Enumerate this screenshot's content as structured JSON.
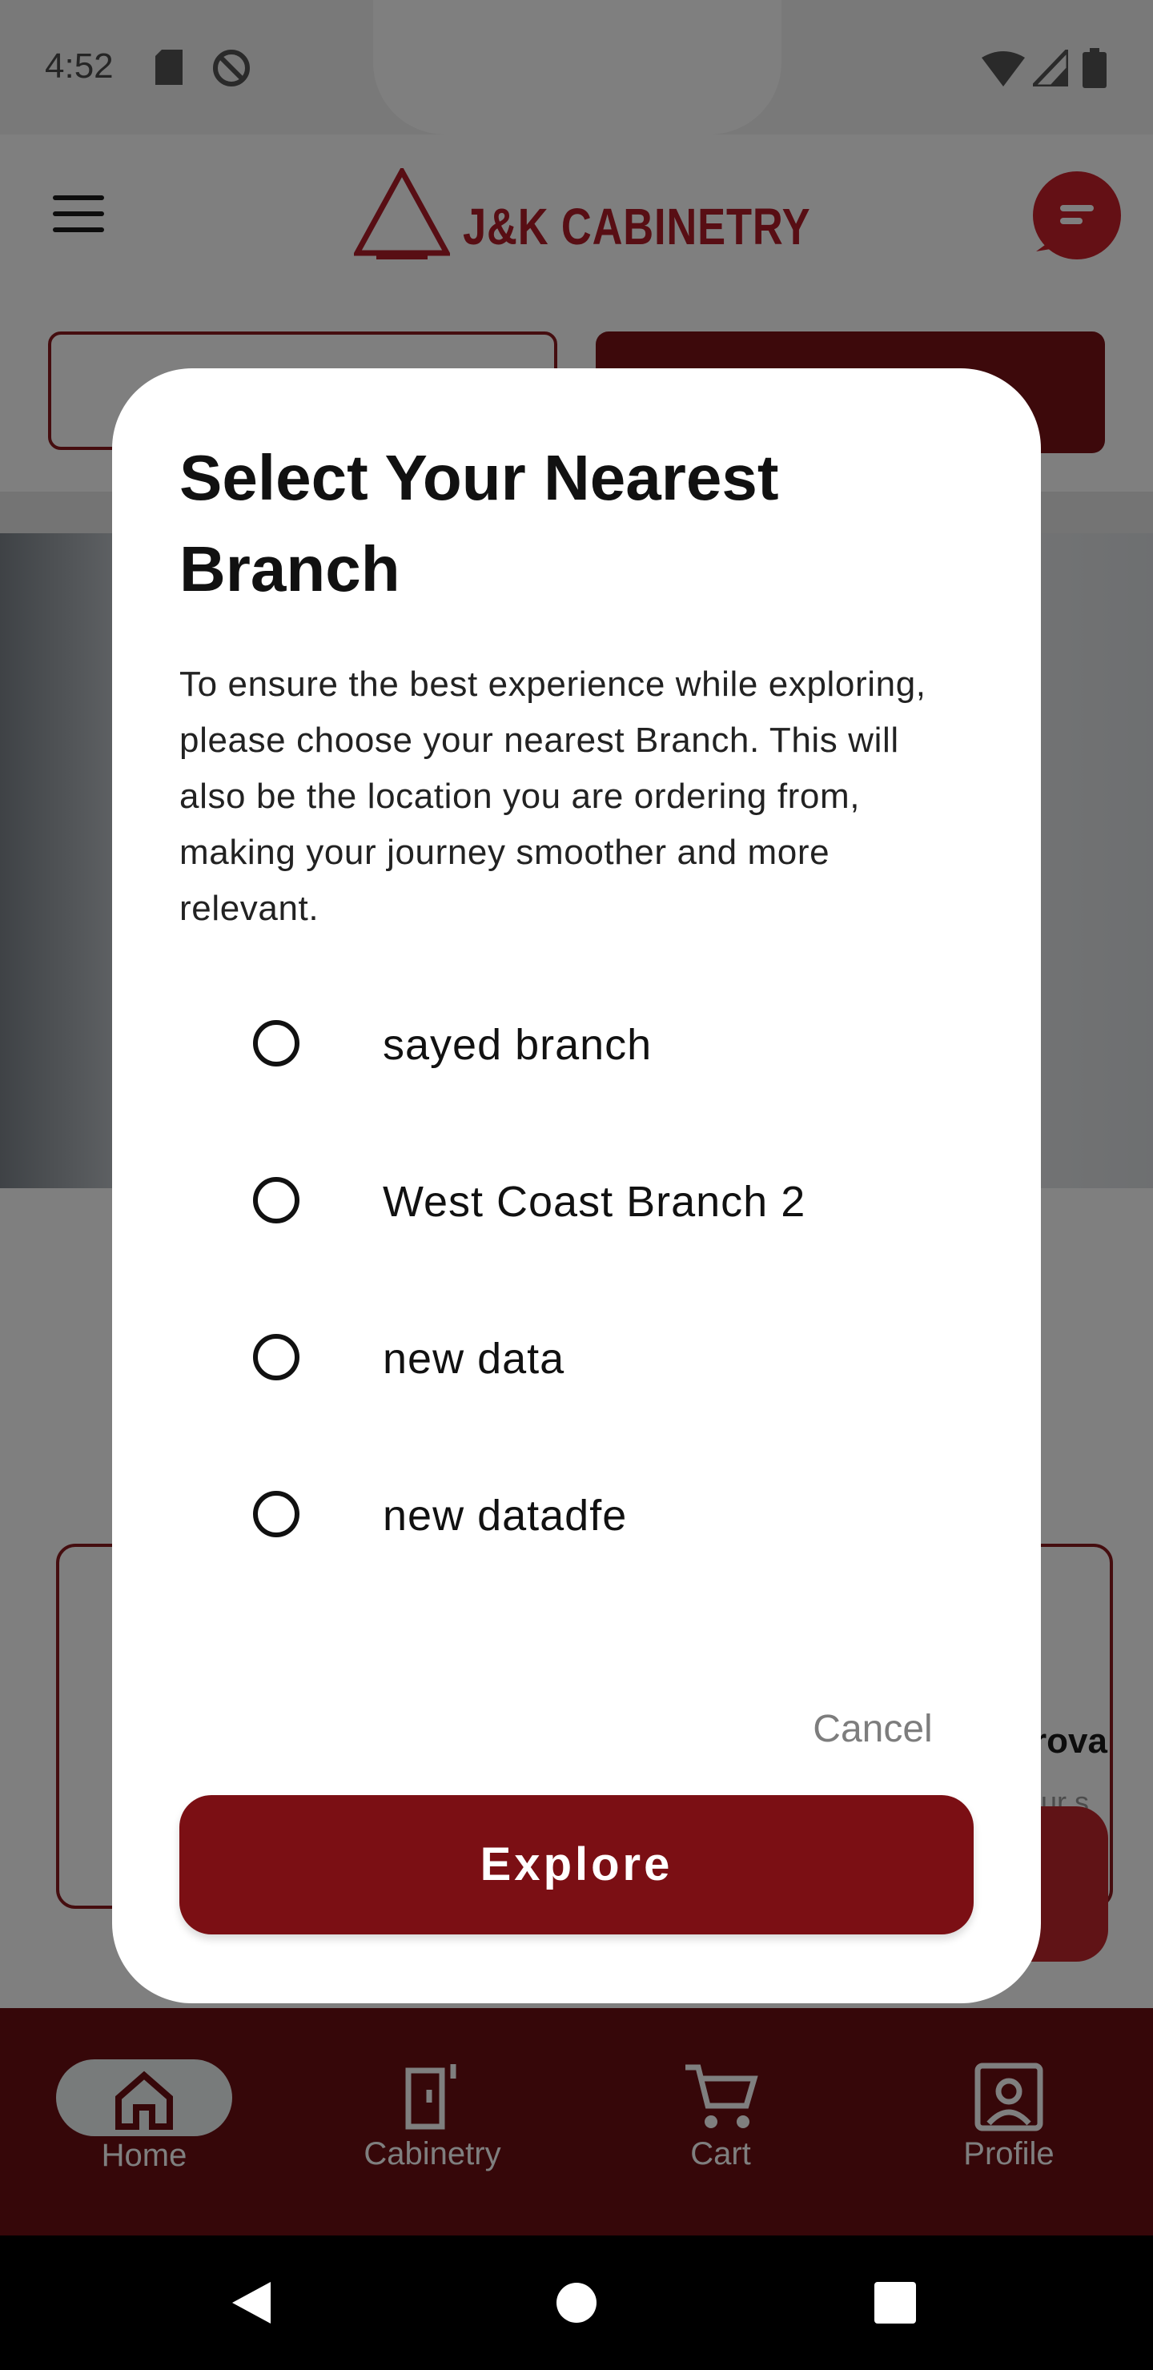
{
  "status_bar": {
    "time": "4:52"
  },
  "app_bar": {
    "logo_text": "J&K CABINETRY"
  },
  "background": {
    "partial_heading": "rova",
    "partial_sub": "ur s"
  },
  "bottom_nav": {
    "items": [
      {
        "label": "Home",
        "icon": "home-icon",
        "selected": true
      },
      {
        "label": "Cabinetry",
        "icon": "cabinet-icon",
        "selected": false
      },
      {
        "label": "Cart",
        "icon": "cart-icon",
        "selected": false
      },
      {
        "label": "Profile",
        "icon": "profile-icon",
        "selected": false
      }
    ]
  },
  "dialog": {
    "title": "Select Your Nearest Branch",
    "body": "To ensure the best experience while exploring, please choose your nearest Branch. This will also be the location you are ordering from, making your journey smoother and more relevant.",
    "options": [
      {
        "label": "sayed branch",
        "selected": false
      },
      {
        "label": "West Coast Branch 2",
        "selected": false
      },
      {
        "label": "new data",
        "selected": false
      },
      {
        "label": "new datadfe",
        "selected": false
      }
    ],
    "cancel_label": "Cancel",
    "explore_label": "Explore"
  },
  "colors": {
    "brand": "#7b0f14",
    "logo": "#b01d28"
  }
}
